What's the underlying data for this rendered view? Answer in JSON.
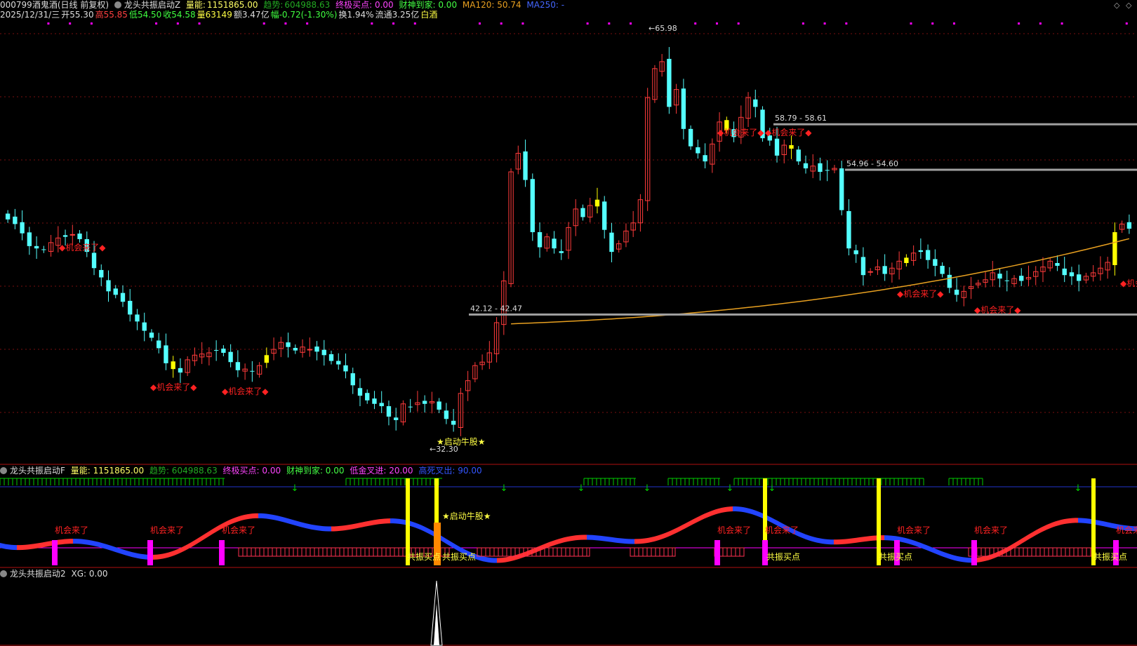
{
  "header": {
    "code": "000799",
    "name": "酒鬼酒",
    "period": "(日线 前复权)",
    "indicator": "龙头共振启动Z",
    "vol_label": "量能:",
    "vol_value": "1151865.00",
    "trend_label": "趋势:",
    "trend_value": "604988.63",
    "final_buy": "终极买点: 0.00",
    "wealth": "财神到家: 0.00",
    "ma120": "MA120: 50.74",
    "ma250": "MA250: -",
    "date": "2025/12/31/三",
    "open": "开55.30",
    "high": "高55.85",
    "low": "低54.50",
    "close": "收54.58",
    "volume": "量63149",
    "amount": "额3.47亿",
    "change": "幅-0.72(-1.30%)",
    "turnover": "换1.94%",
    "float": "流通3.25亿",
    "sector": "白酒"
  },
  "sub1": {
    "title": "龙头共振启动F",
    "vol": "量能: 1151865.00",
    "trend": "趋势: 604988.63",
    "final_buy": "终极买点: 0.00",
    "wealth": "财神到家: 0.00",
    "gold_cross": "低金叉进: 20.00",
    "dead_cross": "高死叉出: 90.00"
  },
  "sub2": {
    "title": "龙头共振启动2",
    "xg": "XG: 0.00"
  },
  "colors": {
    "up": "#ff3b3b",
    "down": "#54ffff",
    "yellow": "#ffff00",
    "ma": "#e8a020",
    "zone": "#a0a0a0",
    "grid": "#7a1010",
    "magenta": "#ff00ff",
    "green": "#00cc00",
    "blue": "#2244ff"
  },
  "chart_data": {
    "type": "candlestick",
    "price_range": [
      31.2,
      67.6
    ],
    "max_label": "65.98",
    "min_label": "32.30",
    "zones": [
      {
        "label": "58.79 - 58.61",
        "price": 58.7
      },
      {
        "label": "54.96 - 54.60",
        "price": 54.78
      },
      {
        "label": "42.12 - 42.47",
        "price": 42.3
      }
    ],
    "signal_text": "◆机会来了◆",
    "start_text": "★启动牛股★",
    "sub_signal": "机会来了",
    "sub_buy": "共振买点",
    "sub_start": "★启动牛股★",
    "closes": [
      50.5,
      50.1,
      49.3,
      48.2,
      48.0,
      47.9,
      48.5,
      48.9,
      49.0,
      49.2,
      48.8,
      47.7,
      46.3,
      45.5,
      44.3,
      44.0,
      43.4,
      42.3,
      41.7,
      40.9,
      40.3,
      39.4,
      38.1,
      37.6,
      37.3,
      38.4,
      38.8,
      38.9,
      39.0,
      39.2,
      39.0,
      38.2,
      37.5,
      37.6,
      37.4,
      37.9,
      38.8,
      39.3,
      39.9,
      39.5,
      39.2,
      39.5,
      39.3,
      39.1,
      38.8,
      38.3,
      38.0,
      37.4,
      36.2,
      35.3,
      34.9,
      34.6,
      34.4,
      33.5,
      33.2,
      34.6,
      34.3,
      34.7,
      34.6,
      34.8,
      34.1,
      33.3,
      32.8,
      35.5,
      36.6,
      37.9,
      38.2,
      39.0,
      41.6,
      45.2,
      54.6,
      56.2,
      53.9,
      49.4,
      48.1,
      49.0,
      48.0,
      47.6,
      49.8,
      51.4,
      50.7,
      51.7,
      52.2,
      49.6,
      47.7,
      48.4,
      49.5,
      50.2,
      52.2,
      61.0,
      63.5,
      64.1,
      60.2,
      61.7,
      58.3,
      56.8,
      56.2,
      55.5,
      57.0,
      58.9,
      58.2,
      57.6,
      59.3,
      61.0,
      60.2,
      57.5,
      57.3,
      56.0,
      56.9,
      56.6,
      55.5,
      54.9,
      55.1,
      54.6,
      54.7,
      54.9,
      51.3,
      48.0,
      47.5,
      45.7,
      46.0,
      46.4,
      45.8,
      46.3,
      46.9,
      47.2,
      47.6,
      47.7,
      47.0,
      46.5,
      45.8,
      44.6,
      44.0,
      44.3,
      44.7,
      45.0,
      45.3,
      45.9,
      45.4,
      45.2,
      45.4,
      45.2,
      45.5,
      46.0,
      46.4,
      46.9,
      46.5,
      45.7,
      45.6,
      45.2,
      45.6,
      45.9,
      46.3,
      46.8,
      49.4,
      50.1,
      49.7
    ]
  }
}
